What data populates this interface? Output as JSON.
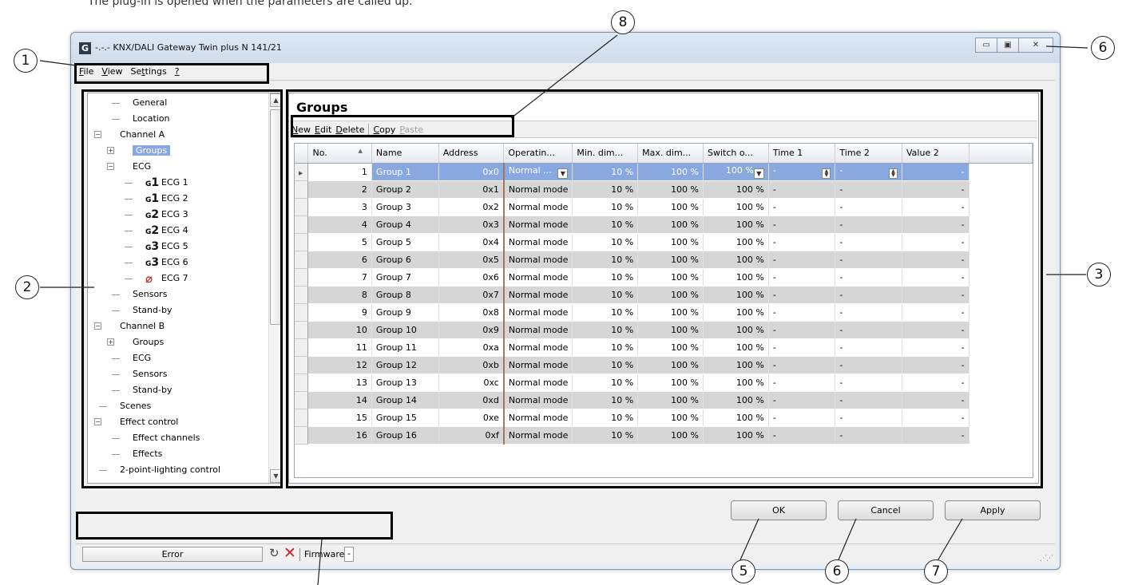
{
  "intro_text": "The plug-in is opened when the parameters are called up.",
  "window": {
    "app_icon_letter": "G",
    "title": "-.-.- KNX/DALI Gateway Twin plus N 141/21",
    "controls": [
      "▭",
      "▣",
      "✕"
    ]
  },
  "menu": [
    {
      "label": "File",
      "key": "F"
    },
    {
      "label": "View",
      "key": "V"
    },
    {
      "label": "Settings",
      "key": "t"
    },
    {
      "label": "?",
      "key": "?"
    }
  ],
  "tree": {
    "items": [
      {
        "label": "General",
        "level": 1,
        "expander": ""
      },
      {
        "label": "Location",
        "level": 1,
        "expander": ""
      },
      {
        "label": "Channel A",
        "level": 0,
        "expander": "−"
      },
      {
        "label": "Groups",
        "level": 1,
        "expander": "+",
        "selected": true
      },
      {
        "label": "ECG",
        "level": 1,
        "expander": "−"
      },
      {
        "label": "ECG 1",
        "level": 2,
        "expander": "",
        "badge": "G1"
      },
      {
        "label": "ECG 2",
        "level": 2,
        "expander": "",
        "badge": "G1"
      },
      {
        "label": "ECG 3",
        "level": 2,
        "expander": "",
        "badge": "G2"
      },
      {
        "label": "ECG 4",
        "level": 2,
        "expander": "",
        "badge": "G2"
      },
      {
        "label": "ECG 5",
        "level": 2,
        "expander": "",
        "badge": "G3"
      },
      {
        "label": "ECG 6",
        "level": 2,
        "expander": "",
        "badge": "G3"
      },
      {
        "label": "ECG 7",
        "level": 2,
        "expander": "",
        "badge": "err"
      },
      {
        "label": "Sensors",
        "level": 1,
        "expander": ""
      },
      {
        "label": "Stand-by",
        "level": 1,
        "expander": ""
      },
      {
        "label": "Channel B",
        "level": 0,
        "expander": "−"
      },
      {
        "label": "Groups",
        "level": 1,
        "expander": "+"
      },
      {
        "label": "ECG",
        "level": 1,
        "expander": ""
      },
      {
        "label": "Sensors",
        "level": 1,
        "expander": ""
      },
      {
        "label": "Stand-by",
        "level": 1,
        "expander": ""
      },
      {
        "label": "Scenes",
        "level": 0,
        "expander": ""
      },
      {
        "label": "Effect control",
        "level": 0,
        "expander": "−"
      },
      {
        "label": "Effect channels",
        "level": 1,
        "expander": ""
      },
      {
        "label": "Effects",
        "level": 1,
        "expander": ""
      },
      {
        "label": "2-point-lighting control",
        "level": 0,
        "expander": ""
      }
    ]
  },
  "groups": {
    "title": "Groups",
    "toolbar": [
      {
        "label": "New",
        "key": "N",
        "enabled": true
      },
      {
        "label": "Edit",
        "key": "E",
        "enabled": true
      },
      {
        "label": "Delete",
        "key": "D",
        "enabled": true
      },
      {
        "sep": true
      },
      {
        "label": "Copy",
        "key": "C",
        "enabled": true
      },
      {
        "label": "Paste",
        "key": "P",
        "enabled": false
      }
    ],
    "columns": [
      "No.",
      "Name",
      "Address",
      "Operatin...",
      "Min. dim...",
      "Max. dim...",
      "Switch o...",
      "Time 1",
      "Time 2",
      "Value 2"
    ],
    "sort_indicator": "▲",
    "rows": [
      {
        "no": "1",
        "name": "Group 1",
        "address": "0x0",
        "mode": "Normal ...",
        "min": "10 %",
        "max": "100 %",
        "switch": "100 %",
        "time1": "-",
        "time2": "-",
        "value2": "-"
      },
      {
        "no": "2",
        "name": "Group 2",
        "address": "0x1",
        "mode": "Normal mode",
        "min": "10 %",
        "max": "100 %",
        "switch": "100 %",
        "time1": "-",
        "time2": "-",
        "value2": "-"
      },
      {
        "no": "3",
        "name": "Group 3",
        "address": "0x2",
        "mode": "Normal mode",
        "min": "10 %",
        "max": "100 %",
        "switch": "100 %",
        "time1": "-",
        "time2": "-",
        "value2": "-"
      },
      {
        "no": "4",
        "name": "Group 4",
        "address": "0x3",
        "mode": "Normal mode",
        "min": "10 %",
        "max": "100 %",
        "switch": "100 %",
        "time1": "-",
        "time2": "-",
        "value2": "-"
      },
      {
        "no": "5",
        "name": "Group 5",
        "address": "0x4",
        "mode": "Normal mode",
        "min": "10 %",
        "max": "100 %",
        "switch": "100 %",
        "time1": "-",
        "time2": "-",
        "value2": "-"
      },
      {
        "no": "6",
        "name": "Group 6",
        "address": "0x5",
        "mode": "Normal mode",
        "min": "10 %",
        "max": "100 %",
        "switch": "100 %",
        "time1": "-",
        "time2": "-",
        "value2": "-"
      },
      {
        "no": "7",
        "name": "Group 7",
        "address": "0x6",
        "mode": "Normal mode",
        "min": "10 %",
        "max": "100 %",
        "switch": "100 %",
        "time1": "-",
        "time2": "-",
        "value2": "-"
      },
      {
        "no": "8",
        "name": "Group 8",
        "address": "0x7",
        "mode": "Normal mode",
        "min": "10 %",
        "max": "100 %",
        "switch": "100 %",
        "time1": "-",
        "time2": "-",
        "value2": "-"
      },
      {
        "no": "9",
        "name": "Group 9",
        "address": "0x8",
        "mode": "Normal mode",
        "min": "10 %",
        "max": "100 %",
        "switch": "100 %",
        "time1": "-",
        "time2": "-",
        "value2": "-"
      },
      {
        "no": "10",
        "name": "Group 10",
        "address": "0x9",
        "mode": "Normal mode",
        "min": "10 %",
        "max": "100 %",
        "switch": "100 %",
        "time1": "-",
        "time2": "-",
        "value2": "-"
      },
      {
        "no": "11",
        "name": "Group 11",
        "address": "0xa",
        "mode": "Normal mode",
        "min": "10 %",
        "max": "100 %",
        "switch": "100 %",
        "time1": "-",
        "time2": "-",
        "value2": "-"
      },
      {
        "no": "12",
        "name": "Group 12",
        "address": "0xb",
        "mode": "Normal mode",
        "min": "10 %",
        "max": "100 %",
        "switch": "100 %",
        "time1": "-",
        "time2": "-",
        "value2": "-"
      },
      {
        "no": "13",
        "name": "Group 13",
        "address": "0xc",
        "mode": "Normal mode",
        "min": "10 %",
        "max": "100 %",
        "switch": "100 %",
        "time1": "-",
        "time2": "-",
        "value2": "-"
      },
      {
        "no": "14",
        "name": "Group 14",
        "address": "0xd",
        "mode": "Normal mode",
        "min": "10 %",
        "max": "100 %",
        "switch": "100 %",
        "time1": "-",
        "time2": "-",
        "value2": "-"
      },
      {
        "no": "15",
        "name": "Group 15",
        "address": "0xe",
        "mode": "Normal mode",
        "min": "10 %",
        "max": "100 %",
        "switch": "100 %",
        "time1": "-",
        "time2": "-",
        "value2": "-"
      },
      {
        "no": "16",
        "name": "Group 16",
        "address": "0xf",
        "mode": "Normal mode",
        "min": "10 %",
        "max": "100 %",
        "switch": "100 %",
        "time1": "-",
        "time2": "-",
        "value2": "-"
      }
    ]
  },
  "buttons": {
    "ok": "OK",
    "cancel": "Cancel",
    "apply": "Apply"
  },
  "status": {
    "error_label": "Error",
    "firmware_label": "Firmware",
    "firmware_value": "-"
  },
  "callouts": {
    "c1": "1",
    "c2": "2",
    "c3": "3",
    "c5": "5",
    "c6a": "6",
    "c6b": "6",
    "c7": "7",
    "c8": "8"
  },
  "colors": {
    "selection": "#8aa8e0",
    "error_red": "#d0202a",
    "highlight_frame": "#000000"
  }
}
